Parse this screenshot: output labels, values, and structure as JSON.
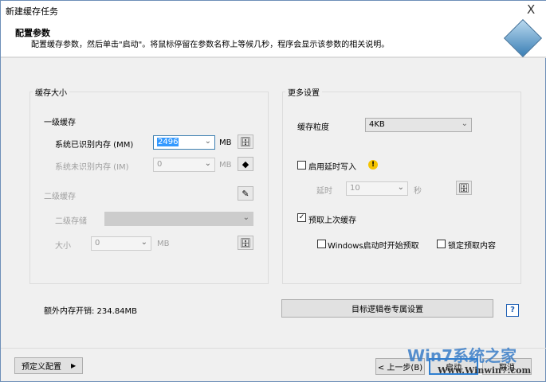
{
  "window": {
    "title": "新建缓存任务",
    "close": "X"
  },
  "header": {
    "title": "配置参数",
    "description": "配置缓存参数，然后单击\"启动\"。将鼠标停留在参数名称上等候几秒，程序会显示该参数的相关说明。"
  },
  "cache_size": {
    "group_label": "缓存大小",
    "l1_label": "一级缓存",
    "mm_label": "系统已识别内存 (MM)",
    "mm_value": "2496",
    "mm_unit": "MB",
    "im_label": "系统未识别内存 (IM)",
    "im_value": "0",
    "im_unit": "MB",
    "l2_label": "二级缓存",
    "l2_storage_label": "二级存储",
    "l2_storage_value": "",
    "size_label": "大小",
    "size_value": "0",
    "size_unit": "MB"
  },
  "more": {
    "group_label": "更多设置",
    "granularity_label": "缓存粒度",
    "granularity_value": "4KB",
    "delay_write_label": "启用延时写入",
    "delay_write_checked": false,
    "delay_label": "延时",
    "delay_value": "10",
    "delay_unit": "秒",
    "prefetch_label": "预取上次缓存",
    "prefetch_checked": true,
    "win_start_label": "Windows启动时开始预取",
    "win_start_checked": false,
    "lock_label": "锁定预取内容",
    "lock_checked": false
  },
  "overhead": "额外内存开销: 234.84MB",
  "target_button": "目标逻辑卷专属设置",
  "help": "?",
  "footer": {
    "preset": "预定义配置",
    "back": "< 上一步(B)",
    "start": "启动",
    "cancel": "取消"
  },
  "watermark": {
    "text": "Win7系统之家",
    "url": "Www.Winwin7.com"
  }
}
